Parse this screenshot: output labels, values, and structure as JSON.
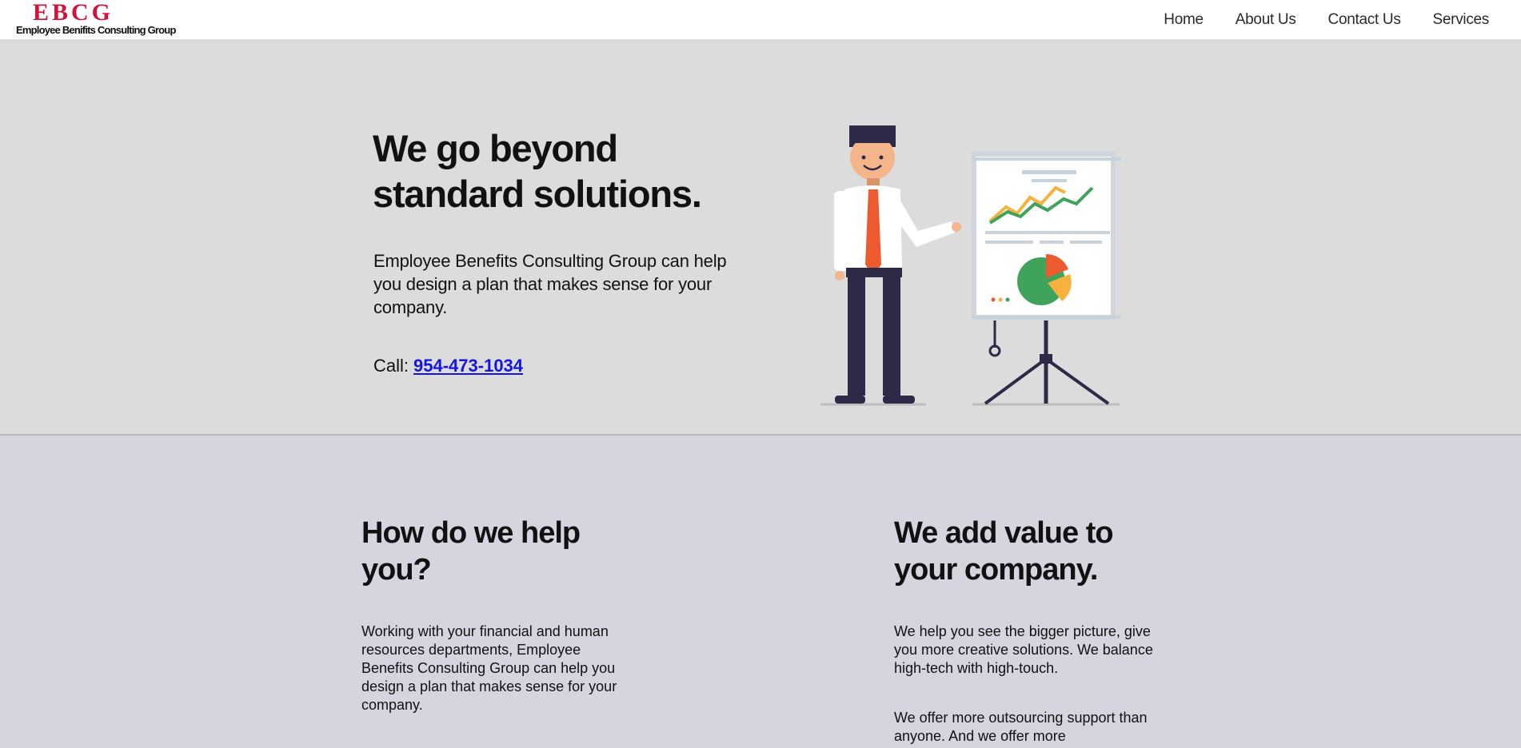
{
  "header": {
    "logo_mark": "EBCG",
    "logo_sub": "Employee Benifits Consulting Group",
    "nav": [
      "Home",
      "About Us",
      "Contact Us",
      "Services"
    ]
  },
  "hero": {
    "title_line1": "We go beyond",
    "title_line2": "standard solutions.",
    "text": "Employee Benefits Consulting Group can help you design a plan that makes sense for your company.",
    "call_label": "Call:",
    "phone": "954-473-1034"
  },
  "left_col": {
    "title_line1": "How do we help",
    "title_line2": "you?",
    "text": "Working with your financial and human resources departments, Employee Benefits Consulting Group can help you design a plan that makes sense for your company."
  },
  "right_col": {
    "title_line1": "We add value to",
    "title_line2": "your company.",
    "text1": "We help you see the bigger picture, give you more creative solutions. We balance high-tech with high-touch.",
    "text2": "We offer more outsourcing support than anyone. And we offer more"
  },
  "colors": {
    "brand_red": "#d2123a",
    "link_blue": "#1515e0",
    "hero_bg": "#dcdcdc",
    "section_bg": "#d6d4df"
  }
}
